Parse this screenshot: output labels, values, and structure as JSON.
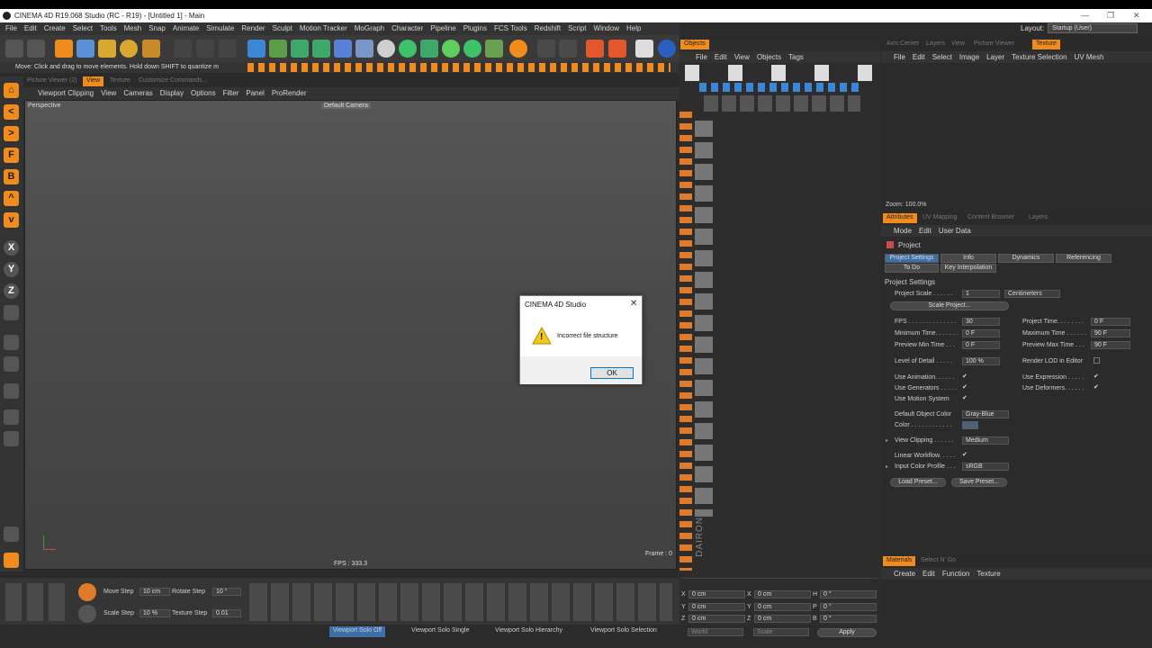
{
  "window": {
    "title": "CINEMA 4D R19.068 Studio (RC - R19) - [Untitled 1] - Main",
    "layout_label": "Layout:",
    "layout_value": "Startup (User)"
  },
  "menu": [
    "File",
    "Edit",
    "Create",
    "Select",
    "Tools",
    "Mesh",
    "Snap",
    "Animate",
    "Simulate",
    "Render",
    "Sculpt",
    "Motion Tracker",
    "MoGraph",
    "Character",
    "Pipeline",
    "Plugins",
    "FCS Tools",
    "Redshift",
    "Script",
    "Window",
    "Help"
  ],
  "status_hint": "Move: Click and drag to move elements. Hold down SHIFT to quantize m",
  "left_toolbar": [
    "⌂",
    "<",
    ">",
    "F",
    "B",
    "^",
    "v",
    "X",
    "Y",
    "Z"
  ],
  "viewport_tabs": [
    "Picture Viewer (2)",
    "View",
    "Texture",
    "Customize Commands..."
  ],
  "viewport_menu": [
    "Viewport Clipping",
    "View",
    "Cameras",
    "Display",
    "Options",
    "Filter",
    "Panel",
    "ProRender"
  ],
  "viewport": {
    "projection": "Perspective",
    "camera": "Default Camera",
    "fps": "FPS : 333.3",
    "frame": "Frame : 0"
  },
  "bottom_tools": {
    "move_step_label": "Move Step",
    "move_step_value": "10 cm",
    "rotate_step_label": "Rotate Step",
    "rotate_step_value": "10 °",
    "scale_step_label": "Scale Step",
    "scale_step_value": "10 %",
    "texture_step_label": "Texture Step",
    "texture_step_value": "0.01"
  },
  "solo_buttons": [
    "Viewport Solo Off",
    "Viewport Solo Single",
    "Viewport Solo Hierarchy",
    "Viewport Solo Selection"
  ],
  "objects_panel": {
    "tab": "Objects",
    "menu": [
      "File",
      "Edit",
      "View",
      "Objects",
      "Tags"
    ],
    "vertical_label": "DAIRON"
  },
  "coords": {
    "rows": [
      {
        "a": "X",
        "av": "0 cm",
        "b": "X",
        "bv": "0 cm",
        "c": "H",
        "cv": "0 °"
      },
      {
        "a": "Y",
        "av": "0 cm",
        "b": "Y",
        "bv": "0 cm",
        "c": "P",
        "cv": "0 °"
      },
      {
        "a": "Z",
        "av": "0 cm",
        "b": "Z",
        "bv": "0 cm",
        "c": "B",
        "cv": "0 °"
      }
    ],
    "world": "World",
    "scale": "Scale",
    "apply": "Apply"
  },
  "texture_panel": {
    "tabs": [
      "Axis Center",
      "Layers",
      "View",
      "Picture Viewer",
      "Texture"
    ],
    "menu": [
      "File",
      "Edit",
      "Select",
      "Image",
      "Layer",
      "Texture Selection",
      "UV Mesh"
    ],
    "zoom": "Zoom: 100.0%"
  },
  "attributes": {
    "tabs": [
      "Attributes",
      "UV Mapping",
      "Content Browser",
      "Layers"
    ],
    "menu": [
      "Mode",
      "Edit",
      "User Data"
    ],
    "object": "Project",
    "subtabs": [
      "Project Settings",
      "Info",
      "Dynamics",
      "Referencing",
      "To Do",
      "Key Interpolation"
    ],
    "section": "Project Settings",
    "project_scale_label": "Project Scale . . . . . .",
    "project_scale_value": "1",
    "project_scale_unit": "Centimeters",
    "scale_project_btn": "Scale Project...",
    "fps_label": "FPS . . . . . . . . . . . . . .",
    "fps_value": "30",
    "project_time_label": "Project Time. . . . . . . .",
    "project_time_value": "0 F",
    "min_time_label": "Minimum Time. . . . . . .",
    "min_time_value": "0 F",
    "max_time_label": "Maximum Time . . . . . .",
    "max_time_value": "90 F",
    "prev_min_label": "Preview Min Time . . .",
    "prev_min_value": "0 F",
    "prev_max_label": "Preview Max Time . . .",
    "prev_max_value": "90 F",
    "lod_label": "Level of Detail . . . . .",
    "lod_value": "100 %",
    "render_lod_label": "Render LOD in Editor",
    "use_animation": "Use Animation. . . . . .",
    "use_expression": "Use Expression . . . . .",
    "use_generators": "Use Generators . . . . .",
    "use_deformers": "Use Deformers. . . . . .",
    "use_motion": "Use Motion System",
    "default_color_label": "Default Object Color",
    "default_color_value": "Gray-Blue",
    "color_label": "Color . . . . . . . . . . . .",
    "view_clipping_label": "View Clipping . . . . . .",
    "view_clipping_value": "Medium",
    "linear_label": "Linear Workflow. . . . .",
    "icc_label": "Input Color Profile . . .",
    "icc_value": "sRGB",
    "load_preset": "Load Preset...",
    "save_preset": "Save Preset...",
    "check": "✔"
  },
  "materials": {
    "tabs": [
      "Materials",
      "Select N' Go"
    ],
    "menu": [
      "Create",
      "Edit",
      "Function",
      "Texture"
    ]
  },
  "dialog": {
    "title": "CINEMA 4D Studio",
    "message": "Incorrect file structure",
    "ok": "OK",
    "close": "✕",
    "warn": "!"
  },
  "colors": {
    "accent": "#f08c1e",
    "panel": "#2b2b2b",
    "selected_tab": "#3d6ea8"
  }
}
